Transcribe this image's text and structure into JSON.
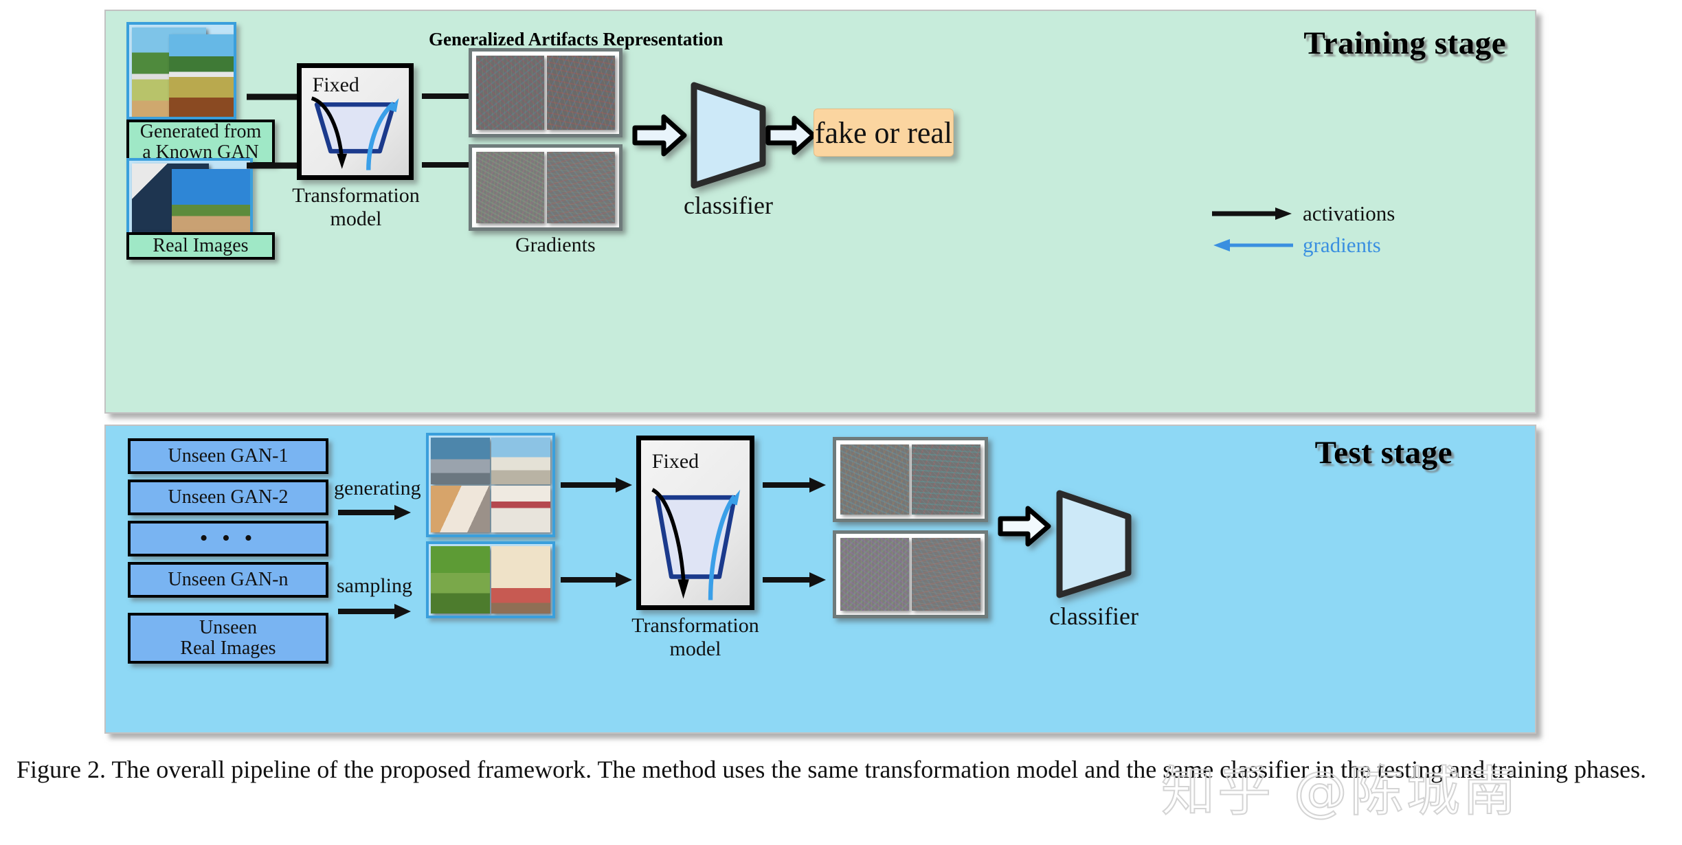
{
  "figure": {
    "caption": "Figure 2. The overall pipeline of the proposed framework. The method uses the same transformation model and the same classifier in the testing and training phases.",
    "watermark": "知乎 @陈城南"
  },
  "training_stage": {
    "title": "Training stage",
    "inputs": [
      {
        "label": "Generated from\na Known GAN",
        "label_line1": "Generated from",
        "label_line2": "a Known GAN"
      },
      {
        "label": "Real Images"
      }
    ],
    "transformation": {
      "fixed_label": "Fixed",
      "caption_line1": "Transformation",
      "caption_line2": "model"
    },
    "artifacts_title": "Generalized Artifacts Representation",
    "gradients_title": "Gradients",
    "classifier_label": "classifier",
    "output_label": "fake or real",
    "legend": [
      {
        "label": "activations",
        "color": "#111111",
        "direction": "right"
      },
      {
        "label": "gradients",
        "color": "#3a8fe0",
        "direction": "left"
      }
    ]
  },
  "test_stage": {
    "title": "Test stage",
    "sources": [
      {
        "label": "Unseen GAN-1"
      },
      {
        "label": "Unseen GAN-2"
      },
      {
        "label": "• • •"
      },
      {
        "label": "Unseen GAN-n"
      },
      {
        "label_line1": "Unseen",
        "label_line2": "Real Images"
      }
    ],
    "operations": [
      {
        "label": "generating"
      },
      {
        "label": "sampling"
      }
    ],
    "transformation": {
      "fixed_label": "Fixed",
      "caption_line1": "Transformation",
      "caption_line2": "model"
    },
    "classifier_label": "classifier"
  },
  "colors": {
    "training_panel_bg": "#c7ecdb",
    "test_panel_bg": "#8ed8f5",
    "classifier_fill": "#cde9f8",
    "output_bg": "#fbd5a0",
    "gradient_arrow": "#3a8fe0",
    "thumb_border": "#3a9fdc",
    "plate_green": "#9fe8c6",
    "plate_blue": "#79b4f2"
  }
}
